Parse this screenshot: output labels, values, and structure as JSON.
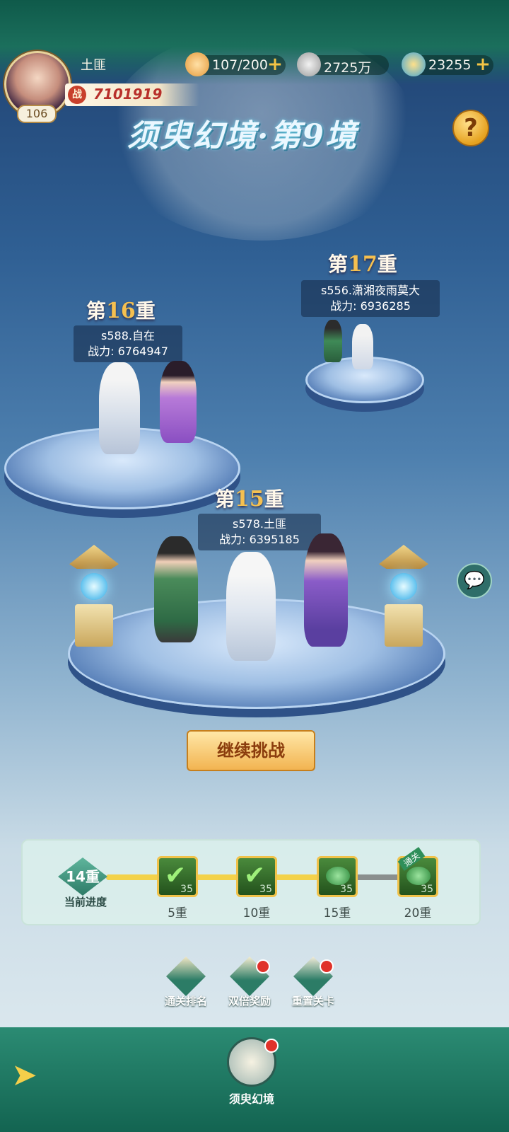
{
  "player": {
    "name": "土匪",
    "level": "106",
    "power_badge": "战",
    "power": "7101919"
  },
  "resources": {
    "stamina": "107/200",
    "silver": "2725万",
    "gems": "23255",
    "plus_symbol": "+"
  },
  "title": "须臾幻境·第9境",
  "help_symbol": "?",
  "floors": [
    {
      "prefix": "第",
      "number": "17",
      "suffix": "重",
      "name": "s556.潇湘夜雨莫大",
      "power_label": "战力:",
      "power": "6936285"
    },
    {
      "prefix": "第",
      "number": "16",
      "suffix": "重",
      "name": "s588.自在",
      "power_label": "战力:",
      "power": "6764947"
    },
    {
      "prefix": "第",
      "number": "15",
      "suffix": "重",
      "name": "s578.土匪",
      "power_label": "战力:",
      "power": "6395185"
    }
  ],
  "continue_label": "继续挑战",
  "progress": {
    "current_badge": "14重",
    "current_label": "当前进度",
    "value_fraction": 0.68,
    "milestones": [
      {
        "label": "5重",
        "count": "35",
        "claimed": true
      },
      {
        "label": "10重",
        "count": "35",
        "claimed": true
      },
      {
        "label": "15重",
        "count": "35",
        "claimed": false
      },
      {
        "label": "20重",
        "count": "35",
        "claimed": false,
        "tag": "通关"
      }
    ]
  },
  "actions": [
    {
      "label": "通关排名",
      "icon": "ranking-podium-icon",
      "badge": false
    },
    {
      "label": "双倍奖励",
      "icon": "gift-box-icon",
      "badge": true
    },
    {
      "label": "重置关卡",
      "icon": "reset-icon",
      "badge": true
    }
  ],
  "nav": {
    "home_label": "须臾幻境"
  },
  "colors": {
    "accent_gold": "#f5c050",
    "panel_green": "#2b8b73",
    "power_red": "#b82f2b"
  }
}
